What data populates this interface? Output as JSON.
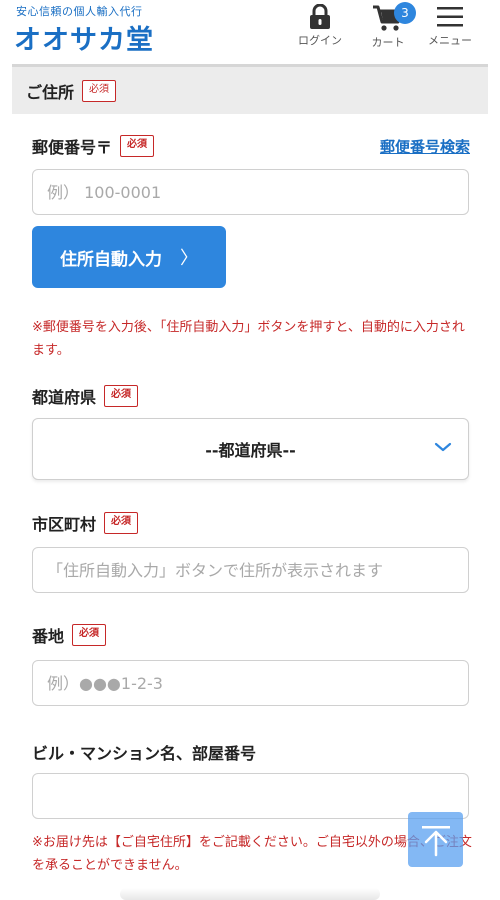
{
  "header": {
    "tagline": "安心信頼の個人輸入代行",
    "logo": "オオサカ堂",
    "login_label": "ログイン",
    "cart_label": "カート",
    "cart_count": "3",
    "menu_label": "メニュー"
  },
  "section": {
    "title": "ご住所",
    "required": "必須"
  },
  "postal": {
    "label": "郵便番号〒",
    "required": "必須",
    "search_link": "郵便番号検索",
    "placeholder": "例） 100-0001",
    "auto_button": "住所自動入力",
    "auto_chevron": "〉",
    "note": "※郵便番号を入力後、「住所自動入力」ボタンを押すと、自動的に入力されます。"
  },
  "prefecture": {
    "label": "都道府県",
    "required": "必須",
    "selected": "--都道府県--"
  },
  "city": {
    "label": "市区町村",
    "required": "必須",
    "placeholder": "「住所自動入力」ボタンで住所が表示されます"
  },
  "street": {
    "label": "番地",
    "required": "必須",
    "placeholder": "例）●●●1-2-3"
  },
  "building": {
    "label": "ビル・マンション名、部屋番号",
    "value": "",
    "note": "※お届け先は【ご自宅住所】をご記載ください。ご自宅以外の場合、ご注文を承ることができません。"
  },
  "colors": {
    "brand_blue": "#1a6fc4",
    "button_blue": "#2e86de",
    "required_red": "#c62828"
  }
}
